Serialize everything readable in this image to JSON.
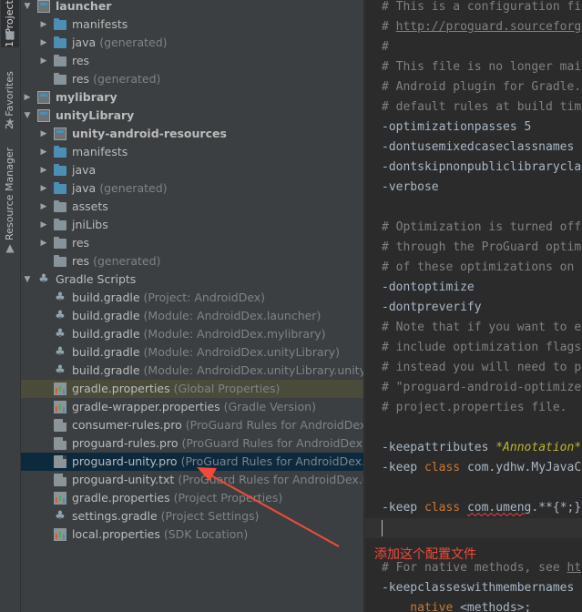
{
  "toolstrip": {
    "project_tab": "1: Project",
    "favorites_tab": "2: Favorites",
    "resource_tab": "Resource Manager"
  },
  "tree": {
    "rows": [
      {
        "name": "launcher",
        "secondary": "",
        "kind": "module",
        "bold": true,
        "arrow": "down",
        "selected": false
      },
      {
        "name": "manifests",
        "secondary": "",
        "kind": "folder-blue",
        "bold": false,
        "arrow": "right",
        "selected": false
      },
      {
        "name": "java",
        "secondary": "(generated)",
        "kind": "folder-gen",
        "bold": false,
        "arrow": "right",
        "selected": false
      },
      {
        "name": "res",
        "secondary": "",
        "kind": "folder-res",
        "bold": false,
        "arrow": "right",
        "selected": false
      },
      {
        "name": "res",
        "secondary": "(generated)",
        "kind": "folder-res",
        "bold": false,
        "arrow": "",
        "selected": false
      },
      {
        "name": "mylibrary",
        "secondary": "",
        "kind": "module",
        "bold": true,
        "arrow": "right",
        "selected": false
      },
      {
        "name": "unityLibrary",
        "secondary": "",
        "kind": "module",
        "bold": true,
        "arrow": "down",
        "selected": false
      },
      {
        "name": "unity-android-resources",
        "secondary": "",
        "kind": "module",
        "bold": true,
        "arrow": "right",
        "selected": false
      },
      {
        "name": "manifests",
        "secondary": "",
        "kind": "folder-blue",
        "bold": false,
        "arrow": "right",
        "selected": false
      },
      {
        "name": "java",
        "secondary": "",
        "kind": "folder-blue",
        "bold": false,
        "arrow": "right",
        "selected": false
      },
      {
        "name": "java",
        "secondary": "(generated)",
        "kind": "folder-gen",
        "bold": false,
        "arrow": "right",
        "selected": false
      },
      {
        "name": "assets",
        "secondary": "",
        "kind": "folder-res",
        "bold": false,
        "arrow": "right",
        "selected": false
      },
      {
        "name": "jniLibs",
        "secondary": "",
        "kind": "folder-res",
        "bold": false,
        "arrow": "right",
        "selected": false
      },
      {
        "name": "res",
        "secondary": "",
        "kind": "folder-res",
        "bold": false,
        "arrow": "right",
        "selected": false
      },
      {
        "name": "res",
        "secondary": "(generated)",
        "kind": "folder-res",
        "bold": false,
        "arrow": "",
        "selected": false
      },
      {
        "name": "Gradle Scripts",
        "secondary": "",
        "kind": "gradle",
        "bold": false,
        "arrow": "down",
        "selected": false
      },
      {
        "name": "build.gradle",
        "secondary": "(Project: AndroidDex)",
        "kind": "gradle",
        "bold": false,
        "arrow": "",
        "selected": false
      },
      {
        "name": "build.gradle",
        "secondary": "(Module: AndroidDex.launcher)",
        "kind": "gradle",
        "bold": false,
        "arrow": "",
        "selected": false
      },
      {
        "name": "build.gradle",
        "secondary": "(Module: AndroidDex.mylibrary)",
        "kind": "gradle",
        "bold": false,
        "arrow": "",
        "selected": false
      },
      {
        "name": "build.gradle",
        "secondary": "(Module: AndroidDex.unityLibrary)",
        "kind": "gradle",
        "bold": false,
        "arrow": "",
        "selected": false
      },
      {
        "name": "build.gradle",
        "secondary": "(Module: AndroidDex.unityLibrary.unity-an",
        "kind": "gradle",
        "bold": false,
        "arrow": "",
        "selected": false
      },
      {
        "name": "gradle.properties",
        "secondary": "(Global Properties)",
        "kind": "prop",
        "bold": false,
        "arrow": "",
        "selected": false,
        "hl": true
      },
      {
        "name": "gradle-wrapper.properties",
        "secondary": "(Gradle Version)",
        "kind": "prop",
        "bold": false,
        "arrow": "",
        "selected": false
      },
      {
        "name": "consumer-rules.pro",
        "secondary": "(ProGuard Rules for AndroidDex.m",
        "kind": "file",
        "bold": false,
        "arrow": "",
        "selected": false
      },
      {
        "name": "proguard-rules.pro",
        "secondary": "(ProGuard Rules for AndroidDex.m",
        "kind": "file",
        "bold": false,
        "arrow": "",
        "selected": false
      },
      {
        "name": "proguard-unity.pro",
        "secondary": "(ProGuard Rules for AndroidDex.un",
        "kind": "file",
        "bold": false,
        "arrow": "",
        "selected": true
      },
      {
        "name": "proguard-unity.txt",
        "secondary": "(ProGuard Rules for AndroidDex.uni",
        "kind": "file",
        "bold": false,
        "arrow": "",
        "selected": false
      },
      {
        "name": "gradle.properties",
        "secondary": "(Project Properties)",
        "kind": "prop",
        "bold": false,
        "arrow": "",
        "selected": false
      },
      {
        "name": "settings.gradle",
        "secondary": "(Project Settings)",
        "kind": "gradle",
        "bold": false,
        "arrow": "",
        "selected": false
      },
      {
        "name": "local.properties",
        "secondary": "(SDK Location)",
        "kind": "prop",
        "bold": false,
        "arrow": "",
        "selected": false
      }
    ]
  },
  "editor": {
    "lines": [
      [
        {
          "t": "# This is a configuration fi",
          "c": "cmt"
        }
      ],
      [
        {
          "t": "# ",
          "c": "cmt"
        },
        {
          "t": "http://proguard.sourceforg",
          "c": "url"
        }
      ],
      [
        {
          "t": "#",
          "c": "cmt"
        }
      ],
      [
        {
          "t": "# This file is no longer mai",
          "c": "cmt"
        }
      ],
      [
        {
          "t": "# Android plugin for Gradle.",
          "c": "cmt"
        }
      ],
      [
        {
          "t": "# default rules at build tim",
          "c": "cmt"
        }
      ],
      [
        {
          "t": "-optimizationpasses 5",
          "c": "plain"
        }
      ],
      [
        {
          "t": "-dontusemixedcaseclassnames",
          "c": "plain"
        }
      ],
      [
        {
          "t": "-dontskipnonpubliclibrarycla",
          "c": "plain"
        }
      ],
      [
        {
          "t": "-verbose",
          "c": "plain"
        }
      ],
      [
        {
          "t": "",
          "c": "plain"
        }
      ],
      [
        {
          "t": "# Optimization is turned off",
          "c": "cmt"
        }
      ],
      [
        {
          "t": "# through the ProGuard optim",
          "c": "cmt"
        }
      ],
      [
        {
          "t": "# of these optimizations on ",
          "c": "cmt"
        }
      ],
      [
        {
          "t": "-dontoptimize",
          "c": "plain"
        }
      ],
      [
        {
          "t": "-dontpreverify",
          "c": "plain"
        }
      ],
      [
        {
          "t": "# Note that if you want to e",
          "c": "cmt"
        }
      ],
      [
        {
          "t": "# include optimization flags",
          "c": "cmt"
        }
      ],
      [
        {
          "t": "# instead you will need to p",
          "c": "cmt"
        }
      ],
      [
        {
          "t": "# \"proguard-android-optimize",
          "c": "cmt"
        }
      ],
      [
        {
          "t": "# project.properties file.",
          "c": "cmt"
        }
      ],
      [
        {
          "t": "",
          "c": "plain"
        }
      ],
      [
        {
          "t": "-keepattributes ",
          "c": "plain"
        },
        {
          "t": "*Annotation*",
          "c": "ann"
        }
      ],
      [
        {
          "t": "-keep ",
          "c": "plain"
        },
        {
          "t": "class ",
          "c": "kw"
        },
        {
          "t": "com.ydhw.MyJavaC",
          "c": "plain"
        }
      ],
      [
        {
          "t": "",
          "c": "plain"
        }
      ],
      [
        {
          "t": "-keep ",
          "c": "plain"
        },
        {
          "t": "class ",
          "c": "kw"
        },
        {
          "t": "com.umeng",
          "c": "wav"
        },
        {
          "t": ".**{*;}",
          "c": "plain"
        }
      ],
      [
        {
          "t": "",
          "c": "plain"
        }
      ],
      [
        {
          "t": "",
          "c": "plain"
        }
      ],
      [
        {
          "t": "# For native methods, see ",
          "c": "cmt"
        },
        {
          "t": "ht",
          "c": "url"
        }
      ],
      [
        {
          "t": "-keepclasseswithmembernames ",
          "c": "plain"
        }
      ],
      [
        {
          "t": "    native ",
          "c": "kw"
        },
        {
          "t": "<methods>;",
          "c": "plain"
        }
      ]
    ],
    "current_line": 26
  },
  "annotation": {
    "text": "添加这个配置文件",
    "color": "#f04b3a"
  }
}
